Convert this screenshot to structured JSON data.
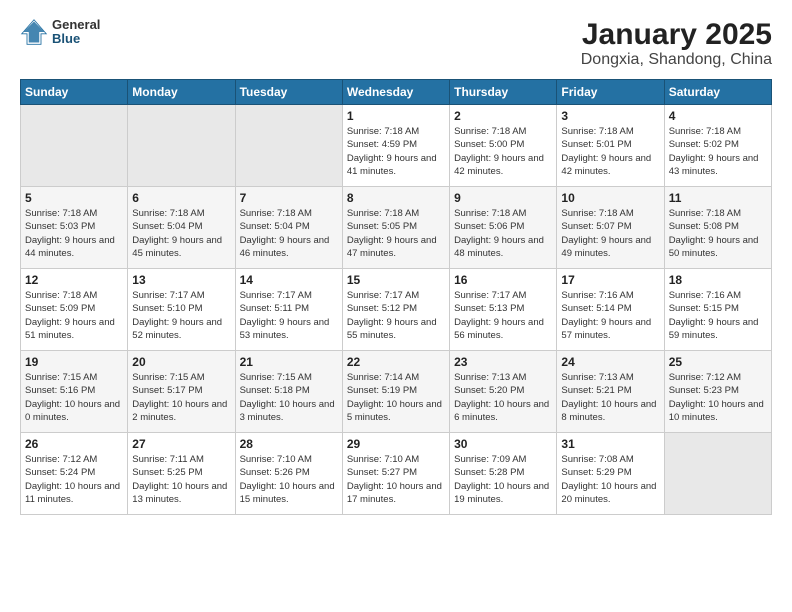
{
  "header": {
    "logo_general": "General",
    "logo_blue": "Blue",
    "title": "January 2025",
    "subtitle": "Dongxia, Shandong, China"
  },
  "days_of_week": [
    "Sunday",
    "Monday",
    "Tuesday",
    "Wednesday",
    "Thursday",
    "Friday",
    "Saturday"
  ],
  "weeks": [
    [
      {
        "day": "",
        "content": ""
      },
      {
        "day": "",
        "content": ""
      },
      {
        "day": "",
        "content": ""
      },
      {
        "day": "1",
        "content": "Sunrise: 7:18 AM\nSunset: 4:59 PM\nDaylight: 9 hours and 41 minutes."
      },
      {
        "day": "2",
        "content": "Sunrise: 7:18 AM\nSunset: 5:00 PM\nDaylight: 9 hours and 42 minutes."
      },
      {
        "day": "3",
        "content": "Sunrise: 7:18 AM\nSunset: 5:01 PM\nDaylight: 9 hours and 42 minutes."
      },
      {
        "day": "4",
        "content": "Sunrise: 7:18 AM\nSunset: 5:02 PM\nDaylight: 9 hours and 43 minutes."
      }
    ],
    [
      {
        "day": "5",
        "content": "Sunrise: 7:18 AM\nSunset: 5:03 PM\nDaylight: 9 hours and 44 minutes."
      },
      {
        "day": "6",
        "content": "Sunrise: 7:18 AM\nSunset: 5:04 PM\nDaylight: 9 hours and 45 minutes."
      },
      {
        "day": "7",
        "content": "Sunrise: 7:18 AM\nSunset: 5:04 PM\nDaylight: 9 hours and 46 minutes."
      },
      {
        "day": "8",
        "content": "Sunrise: 7:18 AM\nSunset: 5:05 PM\nDaylight: 9 hours and 47 minutes."
      },
      {
        "day": "9",
        "content": "Sunrise: 7:18 AM\nSunset: 5:06 PM\nDaylight: 9 hours and 48 minutes."
      },
      {
        "day": "10",
        "content": "Sunrise: 7:18 AM\nSunset: 5:07 PM\nDaylight: 9 hours and 49 minutes."
      },
      {
        "day": "11",
        "content": "Sunrise: 7:18 AM\nSunset: 5:08 PM\nDaylight: 9 hours and 50 minutes."
      }
    ],
    [
      {
        "day": "12",
        "content": "Sunrise: 7:18 AM\nSunset: 5:09 PM\nDaylight: 9 hours and 51 minutes."
      },
      {
        "day": "13",
        "content": "Sunrise: 7:17 AM\nSunset: 5:10 PM\nDaylight: 9 hours and 52 minutes."
      },
      {
        "day": "14",
        "content": "Sunrise: 7:17 AM\nSunset: 5:11 PM\nDaylight: 9 hours and 53 minutes."
      },
      {
        "day": "15",
        "content": "Sunrise: 7:17 AM\nSunset: 5:12 PM\nDaylight: 9 hours and 55 minutes."
      },
      {
        "day": "16",
        "content": "Sunrise: 7:17 AM\nSunset: 5:13 PM\nDaylight: 9 hours and 56 minutes."
      },
      {
        "day": "17",
        "content": "Sunrise: 7:16 AM\nSunset: 5:14 PM\nDaylight: 9 hours and 57 minutes."
      },
      {
        "day": "18",
        "content": "Sunrise: 7:16 AM\nSunset: 5:15 PM\nDaylight: 9 hours and 59 minutes."
      }
    ],
    [
      {
        "day": "19",
        "content": "Sunrise: 7:15 AM\nSunset: 5:16 PM\nDaylight: 10 hours and 0 minutes."
      },
      {
        "day": "20",
        "content": "Sunrise: 7:15 AM\nSunset: 5:17 PM\nDaylight: 10 hours and 2 minutes."
      },
      {
        "day": "21",
        "content": "Sunrise: 7:15 AM\nSunset: 5:18 PM\nDaylight: 10 hours and 3 minutes."
      },
      {
        "day": "22",
        "content": "Sunrise: 7:14 AM\nSunset: 5:19 PM\nDaylight: 10 hours and 5 minutes."
      },
      {
        "day": "23",
        "content": "Sunrise: 7:13 AM\nSunset: 5:20 PM\nDaylight: 10 hours and 6 minutes."
      },
      {
        "day": "24",
        "content": "Sunrise: 7:13 AM\nSunset: 5:21 PM\nDaylight: 10 hours and 8 minutes."
      },
      {
        "day": "25",
        "content": "Sunrise: 7:12 AM\nSunset: 5:23 PM\nDaylight: 10 hours and 10 minutes."
      }
    ],
    [
      {
        "day": "26",
        "content": "Sunrise: 7:12 AM\nSunset: 5:24 PM\nDaylight: 10 hours and 11 minutes."
      },
      {
        "day": "27",
        "content": "Sunrise: 7:11 AM\nSunset: 5:25 PM\nDaylight: 10 hours and 13 minutes."
      },
      {
        "day": "28",
        "content": "Sunrise: 7:10 AM\nSunset: 5:26 PM\nDaylight: 10 hours and 15 minutes."
      },
      {
        "day": "29",
        "content": "Sunrise: 7:10 AM\nSunset: 5:27 PM\nDaylight: 10 hours and 17 minutes."
      },
      {
        "day": "30",
        "content": "Sunrise: 7:09 AM\nSunset: 5:28 PM\nDaylight: 10 hours and 19 minutes."
      },
      {
        "day": "31",
        "content": "Sunrise: 7:08 AM\nSunset: 5:29 PM\nDaylight: 10 hours and 20 minutes."
      },
      {
        "day": "",
        "content": ""
      }
    ]
  ]
}
